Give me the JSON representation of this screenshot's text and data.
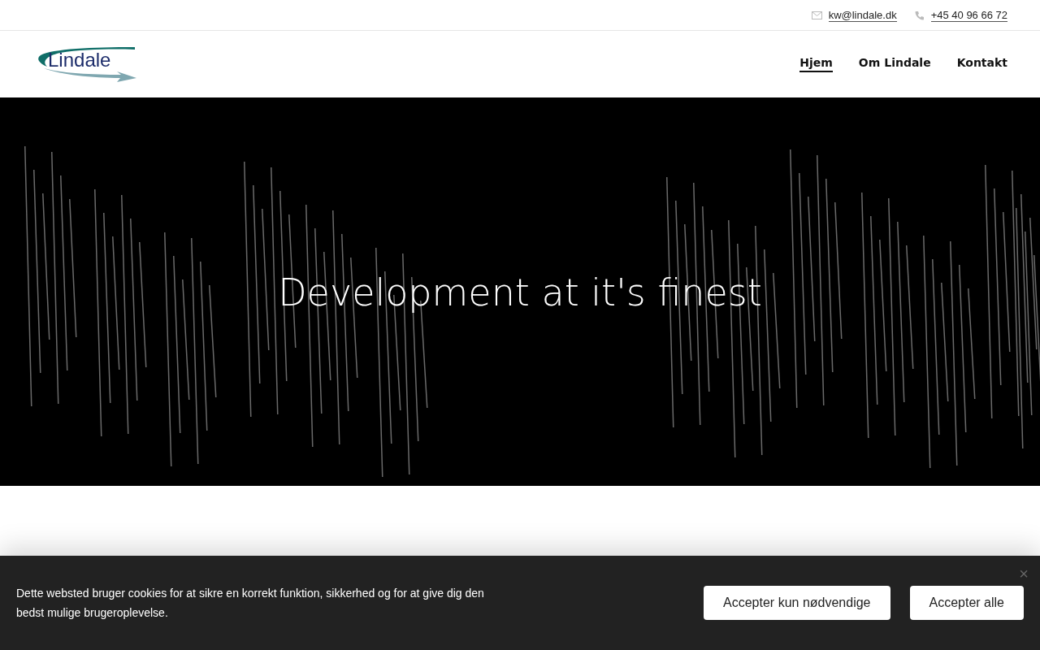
{
  "top_bar": {
    "email": "kw@lindale.dk",
    "phone": "+45 40 96 66 72"
  },
  "header": {
    "logo_text": "Lindale",
    "nav": [
      {
        "label": "Hjem",
        "selected": true
      },
      {
        "label": "Om Lindale",
        "selected": false
      },
      {
        "label": "Kontakt",
        "selected": false
      }
    ]
  },
  "hero": {
    "kind": "picture",
    "title": "Development at it's finest"
  },
  "cookie_banner": {
    "text": "Dette websted bruger cookies for at sikre en korrekt funktion, sikkerhed og for at give dig den bedst mulige brugeroplevelse.",
    "close": "×",
    "buttons": [
      "Accepter kun nødvendige",
      "Accepter alle"
    ]
  }
}
